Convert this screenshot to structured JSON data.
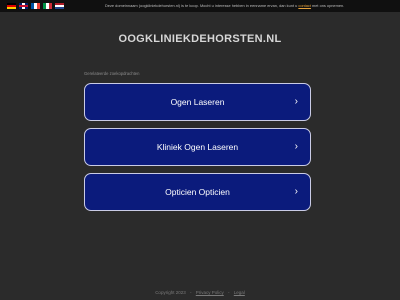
{
  "topbar": {
    "flags": [
      "de",
      "gb",
      "fr",
      "it",
      "nl"
    ],
    "notice_text": "Deze domeinnaam (oogkliniekdehorsten.nl) is te koop. Mocht u interesse hebben in eenname ervan, dan kunt u",
    "notice_link": "contact",
    "notice_tail": "met ons opnemen."
  },
  "header": {
    "domain": "OOGKLINIEKDEHORSTEN.NL"
  },
  "related": {
    "label": "Gerelateerde zoekopdrachten",
    "items": [
      {
        "label": "Ogen Laseren"
      },
      {
        "label": "Kliniek Ogen Laseren"
      },
      {
        "label": "Opticien Opticien"
      }
    ],
    "chevron": "›"
  },
  "footer": {
    "copyright": "Copyright 2023",
    "privacy": "Privacy Policy",
    "legal": "Legal",
    "separator": "-"
  },
  "colors": {
    "background": "#2b2b2b",
    "button_bg": "#0b1b7c",
    "button_border": "#c9cbe6",
    "link": "#e6a23c"
  }
}
